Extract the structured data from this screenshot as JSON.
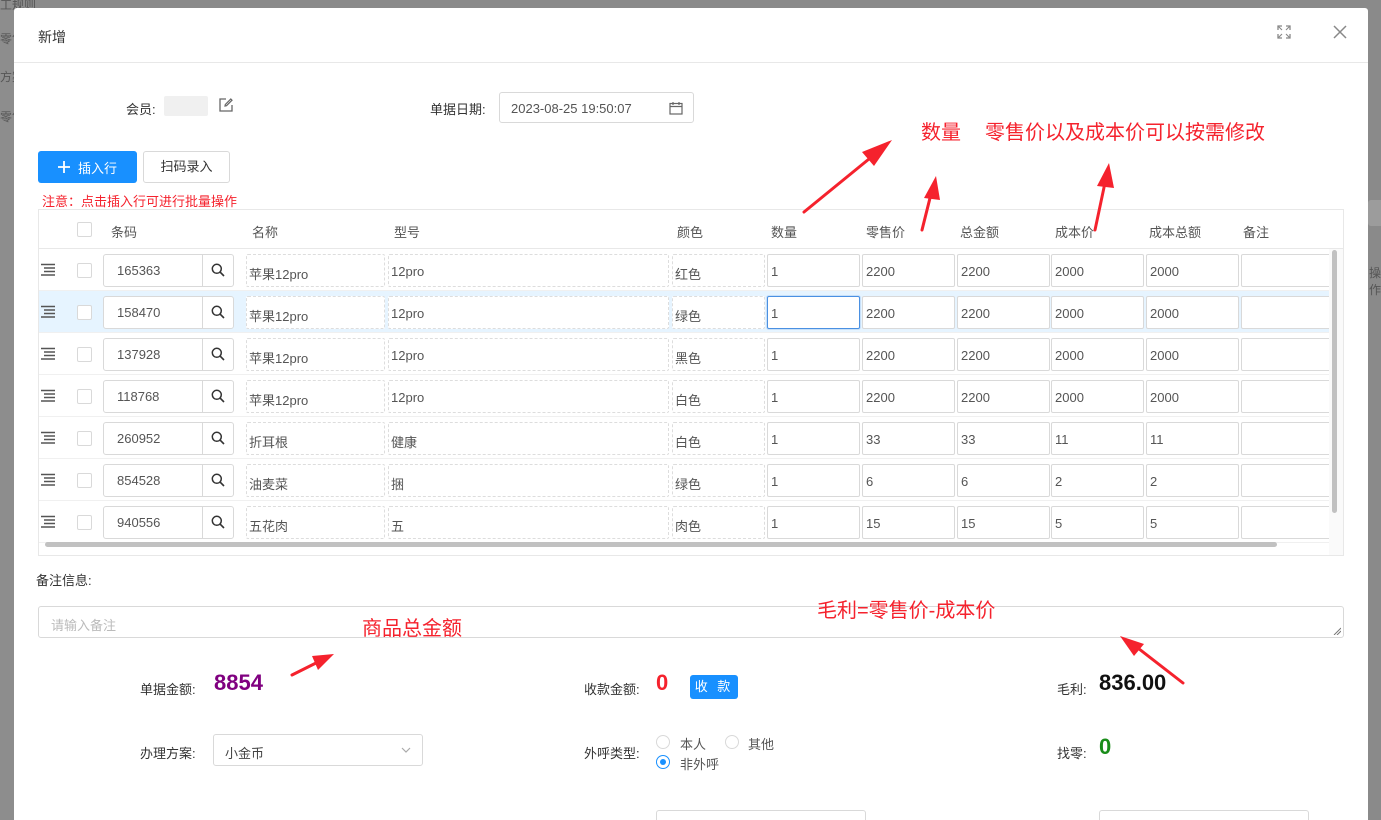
{
  "background": {
    "side_texts": [
      "工规则",
      "零售",
      "方案",
      "零售"
    ],
    "right_text": "操作"
  },
  "modal": {
    "title": "新增",
    "member_label": "会员:",
    "date_label": "单据日期:",
    "date_value": "2023-08-25 19:50:07",
    "insert_row_label": "插入行",
    "scan_label": "扫码录入",
    "notice": "注意：点击插入行可进行批量操作"
  },
  "table": {
    "headers": {
      "code": "条码",
      "name": "名称",
      "model": "型号",
      "color": "颜色",
      "qty": "数量",
      "retail": "零售价",
      "total": "总金额",
      "cost": "成本价",
      "cost_total": "成本总额",
      "remark": "备注"
    },
    "rows": [
      {
        "code": "165363",
        "name": "苹果12pro",
        "model": "12pro",
        "color": "红色",
        "qty": "1",
        "retail": "2200",
        "total": "2200",
        "cost": "2000",
        "cost_total": "2000",
        "remark": ""
      },
      {
        "code": "158470",
        "name": "苹果12pro",
        "model": "12pro",
        "color": "绿色",
        "qty": "1",
        "retail": "2200",
        "total": "2200",
        "cost": "2000",
        "cost_total": "2000",
        "remark": ""
      },
      {
        "code": "137928",
        "name": "苹果12pro",
        "model": "12pro",
        "color": "黑色",
        "qty": "1",
        "retail": "2200",
        "total": "2200",
        "cost": "2000",
        "cost_total": "2000",
        "remark": ""
      },
      {
        "code": "118768",
        "name": "苹果12pro",
        "model": "12pro",
        "color": "白色",
        "qty": "1",
        "retail": "2200",
        "total": "2200",
        "cost": "2000",
        "cost_total": "2000",
        "remark": ""
      },
      {
        "code": "260952",
        "name": "折耳根",
        "model": "健康",
        "color": "白色",
        "qty": "1",
        "retail": "33",
        "total": "33",
        "cost": "11",
        "cost_total": "11",
        "remark": ""
      },
      {
        "code": "854528",
        "name": "油麦菜",
        "model": "捆",
        "color": "绿色",
        "qty": "1",
        "retail": "6",
        "total": "6",
        "cost": "2",
        "cost_total": "2",
        "remark": ""
      },
      {
        "code": "940556",
        "name": "五花肉",
        "model": "五",
        "color": "肉色",
        "qty": "1",
        "retail": "15",
        "total": "15",
        "cost": "5",
        "cost_total": "5",
        "remark": ""
      }
    ]
  },
  "remark": {
    "label": "备注信息:",
    "placeholder": "请输入备注"
  },
  "summary": {
    "doc_amount_label": "单据金额:",
    "doc_amount": "8854",
    "received_label": "收款金额:",
    "received": "0",
    "pay_button": "收 款",
    "profit_label": "毛利:",
    "profit": "836.00",
    "plan_label": "办理方案:",
    "plan_value": "小金币",
    "call_type_label": "外呼类型:",
    "call_options": [
      "本人",
      "其他",
      "非外呼"
    ],
    "call_selected": "非外呼",
    "change_label": "找零:",
    "change": "0"
  },
  "annotations": {
    "qty_note": "数量",
    "price_note": "零售价以及成本价可以按需修改",
    "total_note": "商品总金额",
    "profit_note": "毛利=零售价-成本价"
  },
  "colors": {
    "primary": "#1890ff",
    "annotation_red": "#f5222d",
    "amount_purple": "#800080",
    "change_green": "#1a8d1a"
  }
}
